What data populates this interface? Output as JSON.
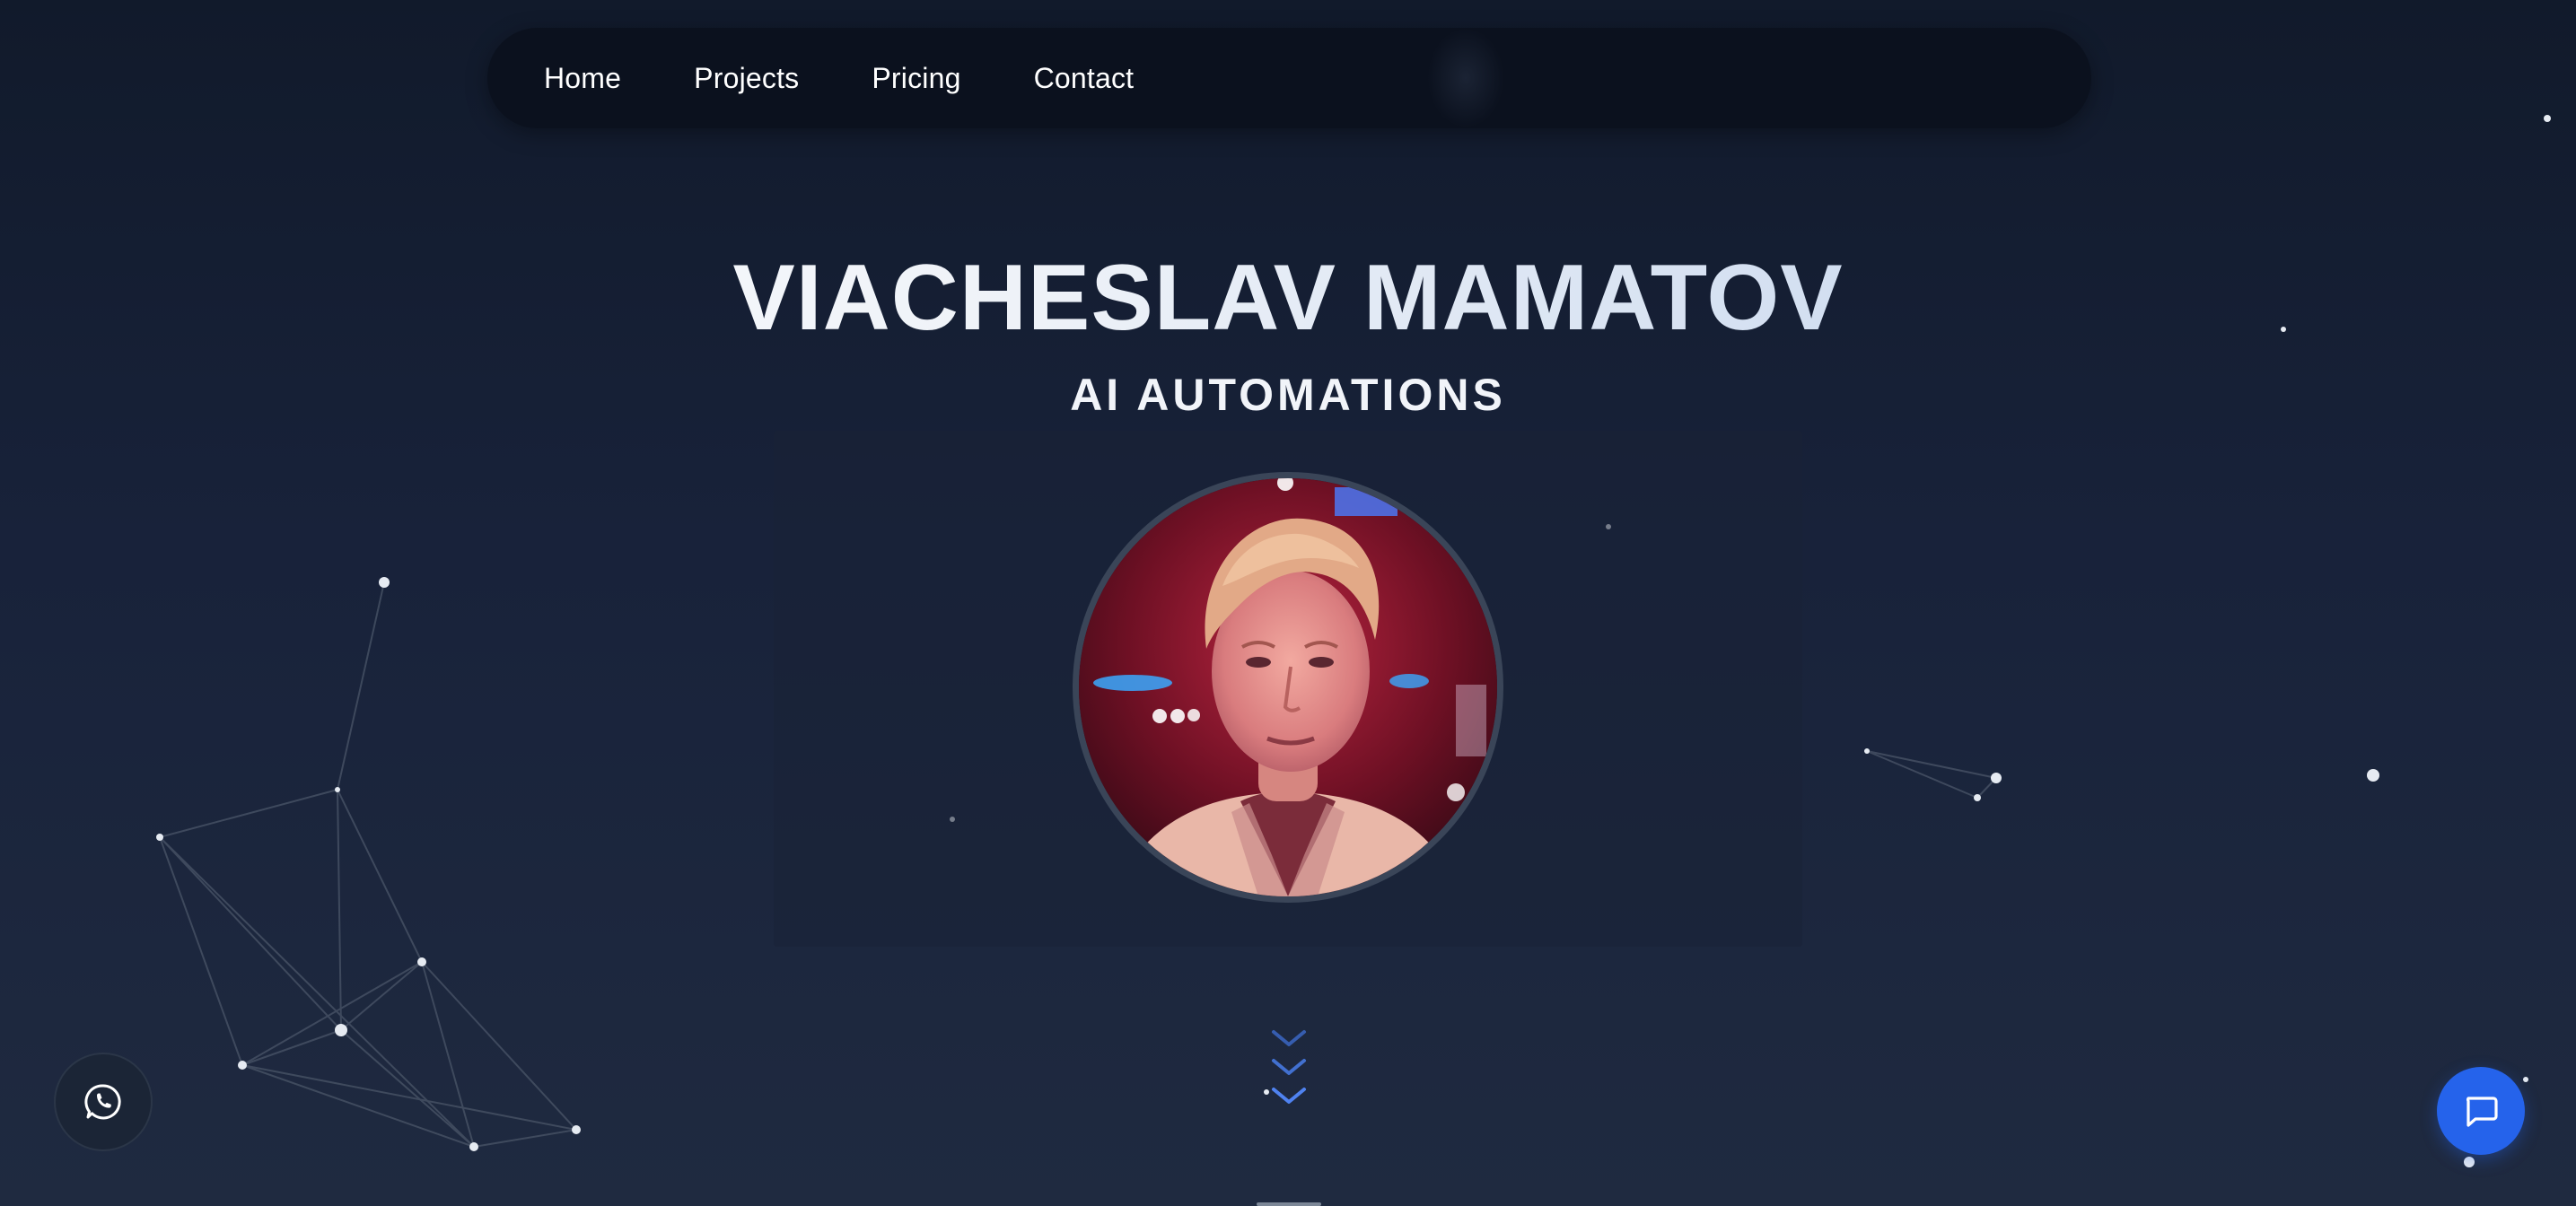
{
  "nav": {
    "items": [
      {
        "label": "Home"
      },
      {
        "label": "Projects"
      },
      {
        "label": "Pricing"
      },
      {
        "label": "Contact"
      }
    ]
  },
  "hero": {
    "name": "VIACHESLAV MAMATOV",
    "subtitle": "AI AUTOMATIONS"
  },
  "colors": {
    "background_top": "#111a2b",
    "background_bottom": "#1f2a40",
    "nav_bg": "#0b111e",
    "accent_blue": "#2563eb",
    "chevron_blue": "#4f7fe0",
    "avatar_border": "#3a4558"
  },
  "icons": {
    "scroll": "triple-chevron-down-icon",
    "whatsapp": "whatsapp-icon",
    "chat": "chat-bubble-icon"
  }
}
